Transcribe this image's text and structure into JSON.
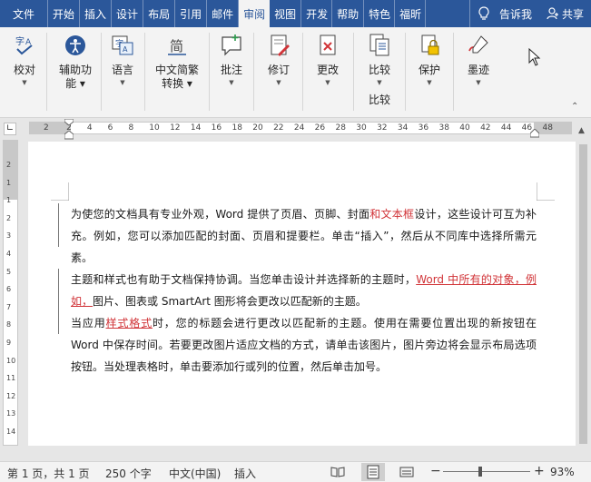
{
  "tabs": [
    "文件",
    "开始",
    "插入",
    "设计",
    "布局",
    "引用",
    "邮件",
    "审阅",
    "视图",
    "开发",
    "帮助",
    "特色",
    "福昕",
    "告诉我",
    "共享"
  ],
  "active_tab": "审阅",
  "ribbon": {
    "proofing": "校对",
    "accessibility_1": "辅助功",
    "accessibility_2": "能",
    "language": "语言",
    "chinese_conv_1": "中文简繁",
    "chinese_conv_2": "转换",
    "comments": "批注",
    "tracking": "修订",
    "changes": "更改",
    "compare_button": "比较",
    "compare_group": "比较",
    "protect": "保护",
    "ink": "墨迹"
  },
  "ruler": {
    "numbers": [
      "2",
      "2",
      "4",
      "6",
      "8",
      "10",
      "12",
      "14",
      "16",
      "18",
      "20",
      "22",
      "24",
      "26",
      "28",
      "30",
      "32",
      "34",
      "36",
      "38",
      "40",
      "42",
      "44",
      "46",
      "48"
    ],
    "vnumbers": [
      "2",
      "1",
      "1",
      "2",
      "3",
      "4",
      "5",
      "6",
      "7",
      "8",
      "9",
      "10",
      "11",
      "12",
      "13",
      "14"
    ]
  },
  "document": {
    "p1_a": "为使您的文档具有专业外观，Word 提供了页眉、页脚、封面",
    "p1_red": "和文本框",
    "p1_b": "设计，这些设计可互为补充。例如，您可以添加匹配的封面、页眉和提要栏。单击“插入”，然后从不同库中选择所需元素。",
    "p2_a": "主题和样式也有助于文档保持协调。当您单击设计并选择新的主题时，",
    "p2_red": "Word 中所有的对象，例如，",
    "p2_b": "图片、图表或 SmartArt 图形将会更改以匹配新的主题。",
    "p3_a": "当应用",
    "p3_red": "样式格式",
    "p3_b": "时，您的标题会进行更改以匹配新的主题。使用在需要位置出现的新按钮在 Word 中保存时间。若要更改图片适应文档的方式，请单击该图片，图片旁边将会显示布局选项按钮。当处理表格时，单击要添加行或列的位置，然后单击加号。"
  },
  "status": {
    "page": "第 1 页，共 1 页",
    "words": "250 个字",
    "lang": "中文(中国)",
    "mode": "插入",
    "zoom": "93%"
  },
  "colors": {
    "accent": "#2b579a",
    "revision": "#d13438"
  }
}
